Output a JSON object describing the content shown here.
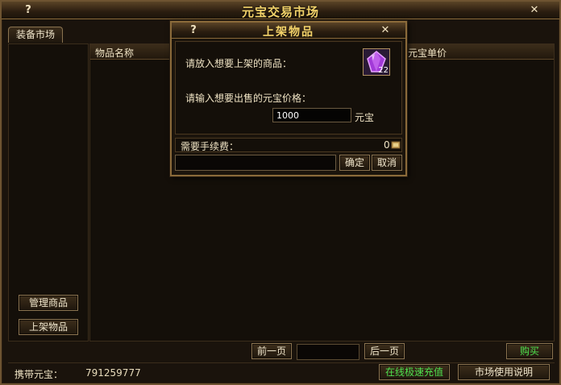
{
  "window": {
    "title": "元宝交易市场",
    "help_icon": "?",
    "close_icon": "✕"
  },
  "tabs": [
    {
      "label": "装备市场"
    }
  ],
  "table": {
    "columns": [
      "物品名称",
      "元宝单价"
    ]
  },
  "left_buttons": {
    "manage": "管理商品",
    "list_item": "上架物品"
  },
  "pagination": {
    "prev": "前一页",
    "next": "后一页",
    "buy": "购买"
  },
  "status": {
    "carried_label": "携带元宝：",
    "carried_value": "791259777",
    "recharge": "在线极速充值",
    "help": "市场使用说明"
  },
  "dialog": {
    "title": "上架物品",
    "help_icon": "?",
    "close_icon": "✕",
    "prompt_item": "请放入想要上架的商品：",
    "prompt_price": "请输入想要出售的元宝价格：",
    "price_value": "1000",
    "price_unit": "元宝",
    "item_icon": "purple-gem-icon",
    "item_count": "22",
    "fee_label": "需要手续费：",
    "fee_value": "0",
    "confirm": "确定",
    "cancel": "取消"
  },
  "colors": {
    "title_gold": "#f3d36a",
    "border_bronze": "#8a6a3a",
    "green_text": "#4ee04e",
    "background": "#1a130c"
  }
}
